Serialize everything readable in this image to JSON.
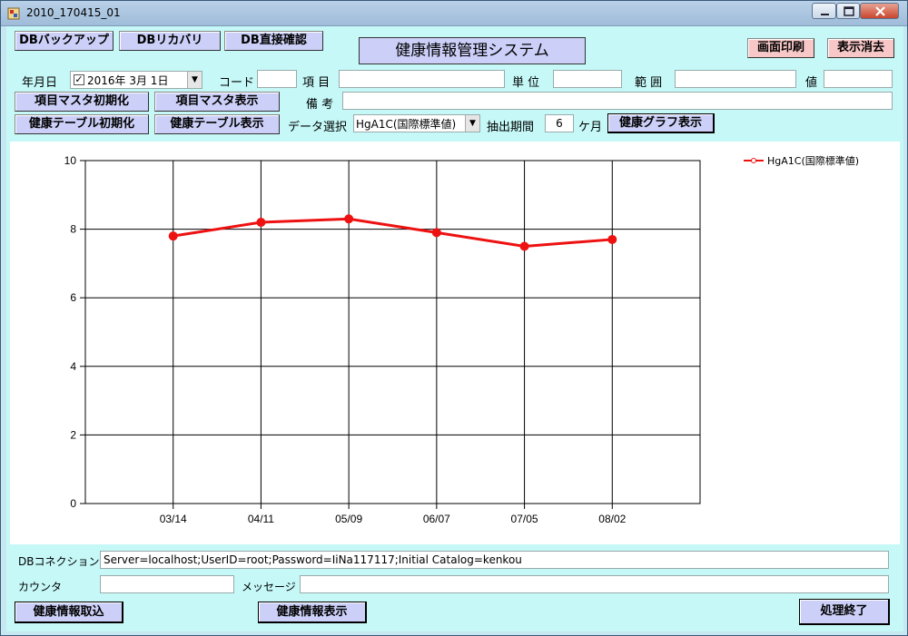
{
  "window": {
    "title": "2010_170415_01"
  },
  "toolbar": {
    "db_backup": "DBバックアップ",
    "db_recovery": "DBリカバリ",
    "db_direct_check": "DB直接確認",
    "app_title": "健康情報管理システム",
    "print_screen": "画面印刷",
    "clear_display": "表示消去"
  },
  "form": {
    "date_label": "年月日",
    "date_value": "2016年  3月  1日",
    "date_checked": "✓",
    "code_label": "コード",
    "code_value": "",
    "item_label": "項 目",
    "item_value": "",
    "unit_label": "単 位",
    "unit_value": "",
    "range_label": "範 囲",
    "range_value": "",
    "value_label": "値",
    "value_value": "",
    "remarks_label": "備 考",
    "remarks_value": "",
    "data_select_label": "データ選択",
    "data_select_value": "HgA1C(国際標準値)",
    "period_label": "抽出期間",
    "period_value": "6",
    "period_unit": "ケ月"
  },
  "buttons": {
    "item_master_init": "項目マスタ初期化",
    "item_master_show": "項目マスタ表示",
    "health_table_init": "健康テーブル初期化",
    "health_table_show": "健康テーブル表示",
    "health_graph_show": "健康グラフ表示",
    "health_import": "健康情報取込",
    "health_show": "健康情報表示",
    "quit": "処理終了"
  },
  "footer": {
    "db_connection_label": "DBコネクション",
    "db_connection_value": "Server=localhost;UserID=root;Password=IiNa117117;Initial Catalog=kenkou",
    "counter_label": "カウンタ",
    "counter_value": "",
    "message_label": "メッセージ",
    "message_value": ""
  },
  "colors": {
    "series": "#ee1111",
    "client_bg": "#c6f8f8",
    "button_bg": "#ccd0f8",
    "button_pink": "#f8c8c8"
  },
  "chart_data": {
    "type": "line",
    "categories": [
      "03/14",
      "04/11",
      "05/09",
      "06/07",
      "07/05",
      "08/02"
    ],
    "series": [
      {
        "name": "HgA1C(国際標準値)",
        "values": [
          7.8,
          8.2,
          8.3,
          7.9,
          7.5,
          7.7
        ]
      }
    ],
    "ylim": [
      0,
      10
    ],
    "yticks": [
      0,
      2,
      4,
      6,
      8,
      10
    ],
    "grid": true,
    "legend": "top-right"
  }
}
